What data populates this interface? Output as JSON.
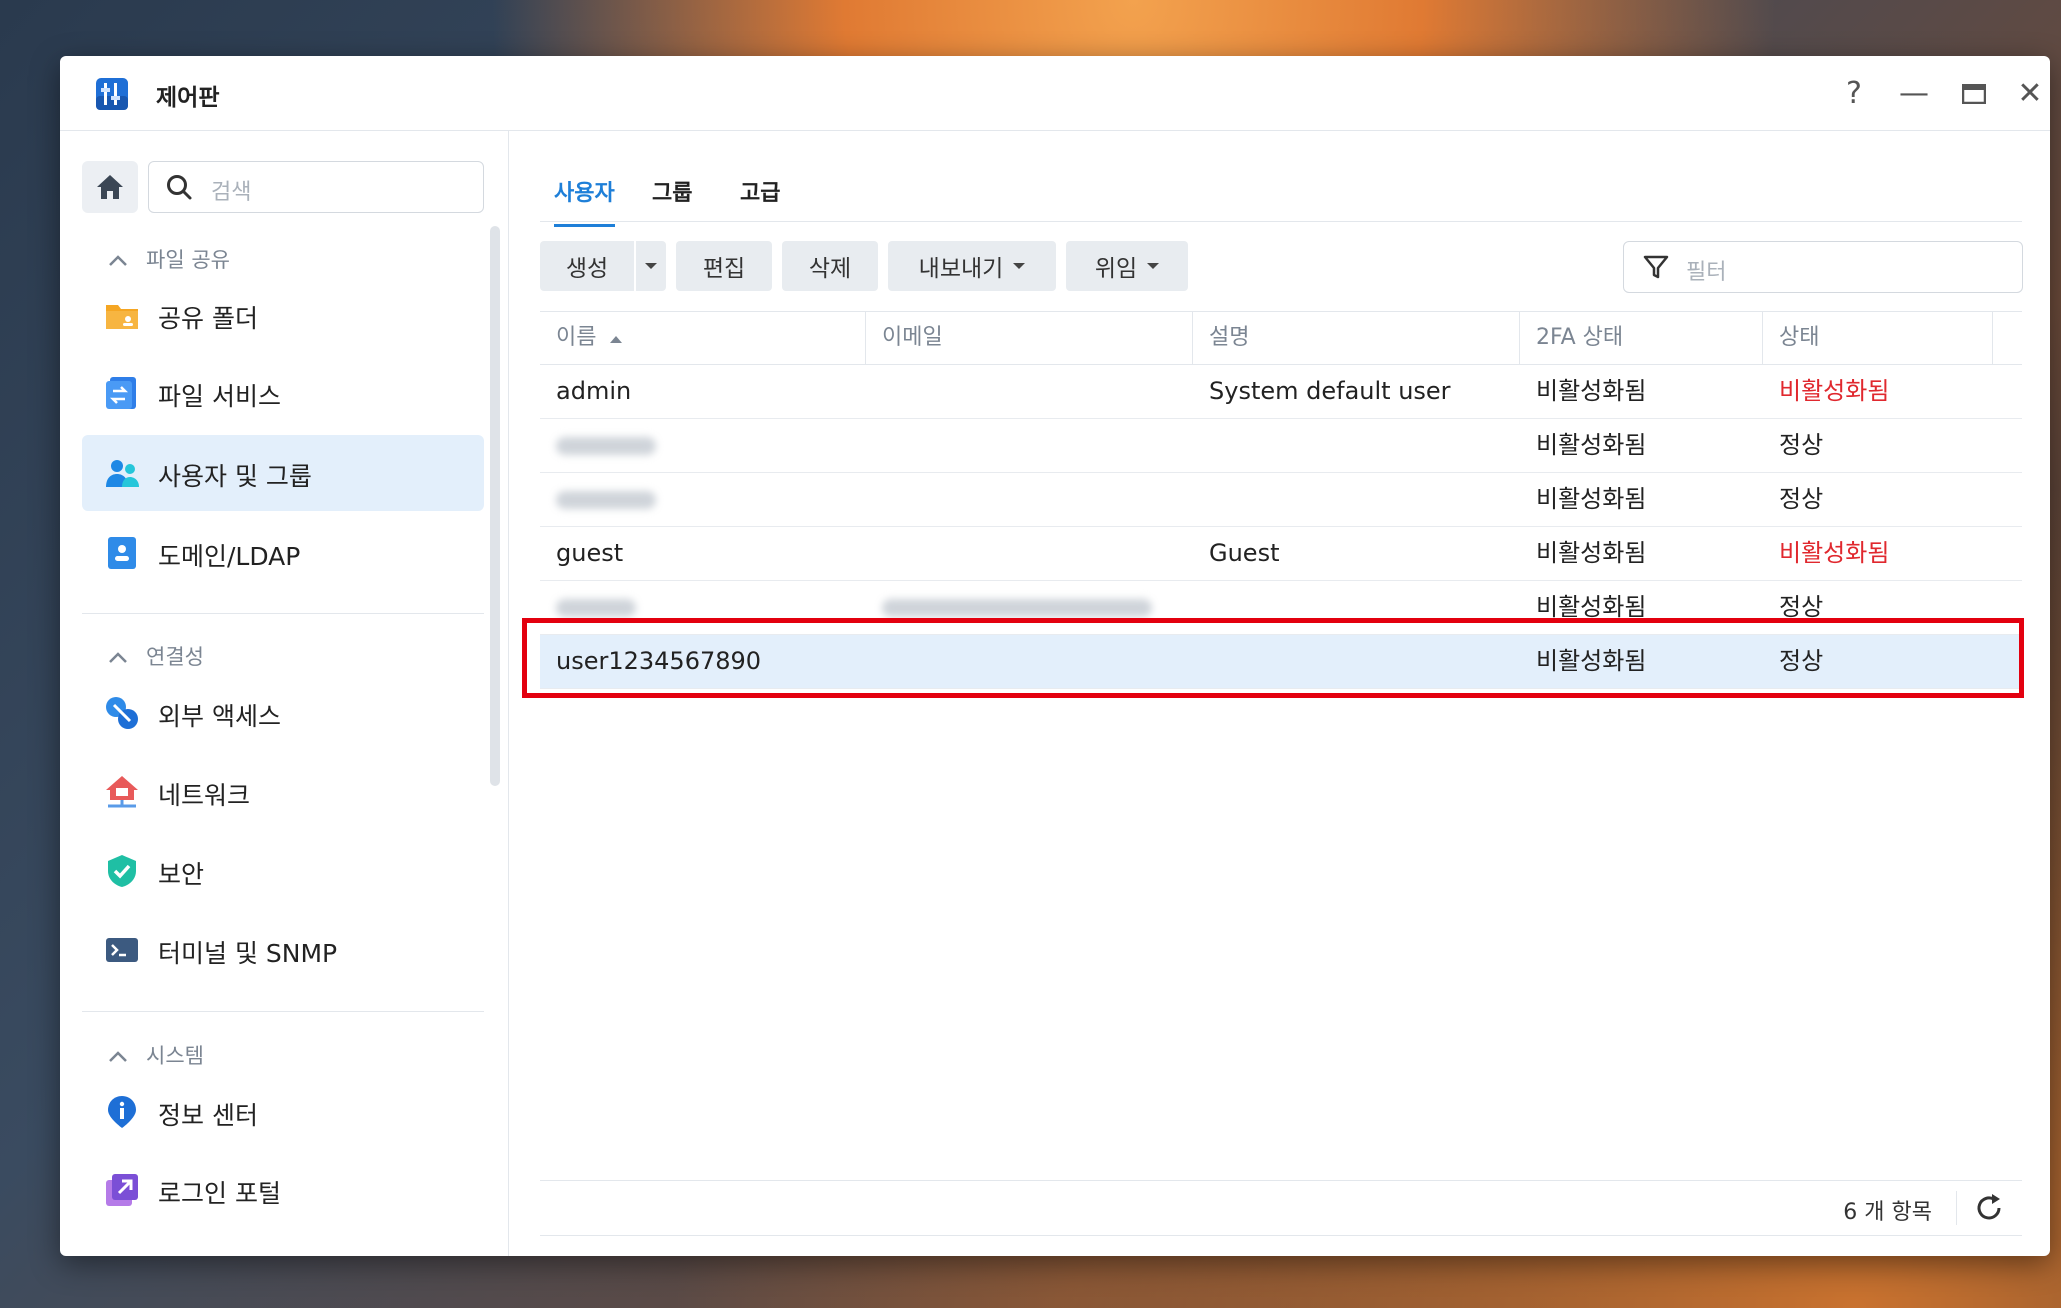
{
  "window": {
    "title": "제어판",
    "controls": [
      "?",
      "—",
      "□",
      "✕"
    ]
  },
  "sidebar": {
    "search_placeholder": "검색",
    "sections": [
      {
        "label": "파일 공유",
        "items": [
          {
            "label": "공유 폴더",
            "icon": "folder-icon"
          },
          {
            "label": "파일 서비스",
            "icon": "file-services-icon"
          },
          {
            "label": "사용자 및 그룹",
            "icon": "users-icon",
            "active": true
          },
          {
            "label": "도메인/LDAP",
            "icon": "directory-icon"
          }
        ]
      },
      {
        "label": "연결성",
        "items": [
          {
            "label": "외부 액세스",
            "icon": "external-access-icon"
          },
          {
            "label": "네트워크",
            "icon": "network-icon"
          },
          {
            "label": "보안",
            "icon": "shield-icon"
          },
          {
            "label": "터미널 및 SNMP",
            "icon": "terminal-icon"
          }
        ]
      },
      {
        "label": "시스템",
        "items": [
          {
            "label": "정보 센터",
            "icon": "info-icon"
          },
          {
            "label": "로그인 포털",
            "icon": "login-portal-icon"
          }
        ]
      }
    ]
  },
  "main": {
    "tabs": [
      {
        "label": "사용자",
        "active": true
      },
      {
        "label": "그룹"
      },
      {
        "label": "고급"
      }
    ],
    "toolbar": {
      "create": "생성",
      "edit": "편집",
      "delete": "삭제",
      "export": "내보내기",
      "delegate": "위임",
      "filter_placeholder": "필터"
    },
    "table": {
      "columns": [
        "이름",
        "이메일",
        "설명",
        "2FA 상태",
        "상태"
      ],
      "rows": [
        {
          "name": "admin",
          "email": "",
          "description": "System default user",
          "twofa": "비활성화됨",
          "status": "비활성화됨",
          "status_color": "#e0282e"
        },
        {
          "name": "",
          "email": "",
          "description": "",
          "twofa": "비활성화됨",
          "status": "정상",
          "blurred_name": true
        },
        {
          "name": "",
          "email": "",
          "description": "",
          "twofa": "비활성화됨",
          "status": "정상",
          "blurred_name": true
        },
        {
          "name": "guest",
          "email": "",
          "description": "Guest",
          "twofa": "비활성화됨",
          "status": "비활성화됨",
          "status_color": "#e0282e"
        },
        {
          "name": "",
          "email": "",
          "description": "",
          "twofa": "비활성화됨",
          "status": "정상",
          "blurred_name": true,
          "blurred_email": true
        },
        {
          "name": "user1234567890",
          "email": "",
          "description": "",
          "twofa": "비활성화됨",
          "status": "정상",
          "selected": true
        }
      ]
    },
    "footer": {
      "count": "6 개 항목"
    }
  },
  "colors": {
    "accent": "#1e7fd8",
    "disabled_red": "#e0282e",
    "highlight_red": "#e3000f",
    "selected_bg": "#e3effb"
  }
}
